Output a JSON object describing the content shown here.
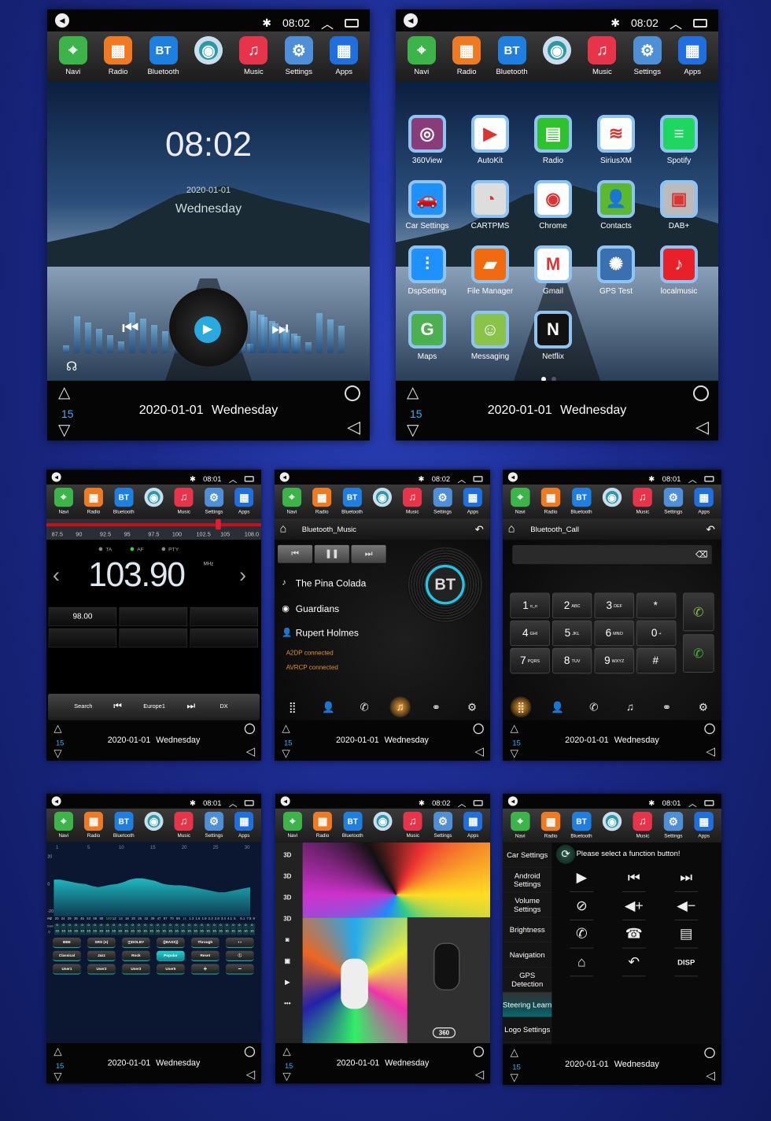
{
  "dock": [
    {
      "label": "Navi",
      "icon": "map-pin-icon",
      "color": "#3cb44a"
    },
    {
      "label": "Radio",
      "icon": "radio-icon",
      "color": "#f07a22"
    },
    {
      "label": "Bluetooth",
      "icon": "bluetooth-icon",
      "color": "#1e7fe0",
      "text": "BT"
    },
    {
      "label": "",
      "icon": "disc-icon",
      "color": "#2a9aa8"
    },
    {
      "label": "Music",
      "icon": "music-note-icon",
      "color": "#e8344a"
    },
    {
      "label": "Settings",
      "icon": "gear-icon",
      "color": "#4f8fd8"
    },
    {
      "label": "Apps",
      "icon": "apps-grid-icon",
      "color": "#1f6fe0"
    }
  ],
  "nav": {
    "volume": "15",
    "date": "2020-01-01",
    "day": "Wednesday"
  },
  "screens": [
    {
      "id": "home",
      "time": "08:02",
      "clock": "08:02",
      "date": "2020-01-01",
      "day": "Wednesday"
    },
    {
      "id": "apps",
      "time": "08:02",
      "page_dots": 2,
      "active_page": 1,
      "apps": [
        {
          "label": "360View",
          "color": "#8a3c7a",
          "glyph": "◎"
        },
        {
          "label": "AutoKit",
          "color": "#ffffff",
          "glyph": "▶"
        },
        {
          "label": "Radio",
          "color": "#2ec22e",
          "glyph": "▤"
        },
        {
          "label": "SiriusXM",
          "color": "#ffffff",
          "glyph": "≋"
        },
        {
          "label": "Spotify",
          "color": "#1ed760",
          "glyph": "≡"
        },
        {
          "label": "Car Settings",
          "color": "#1e90ff",
          "glyph": "🚗"
        },
        {
          "label": "CARTPMS",
          "color": "#dddddd",
          "glyph": "◔"
        },
        {
          "label": "Chrome",
          "color": "#ffffff",
          "glyph": "◉"
        },
        {
          "label": "Contacts",
          "color": "#5cb82e",
          "glyph": "👤"
        },
        {
          "label": "DAB+",
          "color": "#bbbbbb",
          "glyph": "▣"
        },
        {
          "label": "DspSetting",
          "color": "#1e90ff",
          "glyph": "⫶"
        },
        {
          "label": "File Manager",
          "color": "#f26a10",
          "glyph": "▰"
        },
        {
          "label": "Gmail",
          "color": "#ffffff",
          "glyph": "M"
        },
        {
          "label": "GPS Test",
          "color": "#3a6fb0",
          "glyph": "✺"
        },
        {
          "label": "localmusic",
          "color": "#e8202a",
          "glyph": "♪"
        },
        {
          "label": "Maps",
          "color": "#4caf50",
          "glyph": "G"
        },
        {
          "label": "Messaging",
          "color": "#8bc34a",
          "glyph": "☺"
        },
        {
          "label": "Netflix",
          "color": "#111111",
          "glyph": "N"
        }
      ]
    },
    {
      "id": "radio",
      "time": "08:01",
      "scale": [
        "87.5",
        "90",
        "92.5",
        "95",
        "97.5",
        "100",
        "102.5",
        "105",
        "108.0"
      ],
      "tuner_fraction": 0.8,
      "flags": [
        {
          "label": "TA",
          "on": false
        },
        {
          "label": "AF",
          "on": true
        },
        {
          "label": "PTY",
          "on": false
        }
      ],
      "frequency": "103.90",
      "unit": "MHz",
      "presets": [
        "98.00",
        "",
        "",
        "",
        "",
        ""
      ],
      "controls": {
        "search": "Search",
        "station": "Europe1",
        "dx": "DX"
      }
    },
    {
      "id": "bt_music",
      "time": "08:02",
      "title": "Bluetooth_Music",
      "song": "The Pina Colada",
      "album": "Guardians",
      "artist": "Rupert Holmes",
      "status": [
        "A2DP connected",
        "AVRCP connected"
      ],
      "logo": "BT",
      "active_tab": 3
    },
    {
      "id": "bt_call",
      "time": "08:01",
      "title": "Bluetooth_Call",
      "keys": [
        [
          "1",
          "o_o"
        ],
        [
          "2",
          "ABC"
        ],
        [
          "3",
          "DEF"
        ],
        [
          "*",
          ""
        ],
        [
          "4",
          "GHI"
        ],
        [
          "5",
          "JKL"
        ],
        [
          "6",
          "MNO"
        ],
        [
          "0",
          "+"
        ],
        [
          "7",
          "PQRS"
        ],
        [
          "8",
          "TUV"
        ],
        [
          "9",
          "WXYZ"
        ],
        [
          "#",
          ""
        ]
      ],
      "active_tab": 0
    },
    {
      "id": "eq",
      "time": "08:01",
      "bands": [
        "1",
        "5",
        "10",
        "15",
        "20",
        "25",
        "30"
      ],
      "y_ticks": [
        "20",
        "0",
        "-20"
      ],
      "hz": [
        "20",
        "24",
        "29",
        "36",
        "45",
        "53",
        "65",
        "80",
        "100",
        "12",
        "14",
        "18",
        "20",
        "26",
        "32",
        "39",
        "47",
        "57",
        "70",
        "85",
        "1k",
        "1.3",
        "1.6",
        "1.9",
        "2.3",
        "2.8",
        "3.4",
        "4.1",
        "5",
        "6.1",
        "7.5",
        "9"
      ],
      "hz_label": "Hz",
      "gain_label": "Gain",
      "q_label": "Q",
      "gain_value": "0",
      "q_value": "16",
      "gains": [
        4,
        4,
        3,
        2,
        1,
        0.5,
        -1,
        -2,
        -1,
        0,
        0.5,
        2,
        4,
        5,
        5,
        4,
        3,
        1,
        0,
        -0.5,
        -0.5,
        -1,
        -2,
        -3,
        -4,
        -5,
        -6,
        -6,
        -5,
        -4,
        -3,
        -2
      ],
      "buttons": [
        [
          "BBE",
          "SRS (●)",
          "◫DOLBY",
          "((BASS))",
          "Through",
          "◖◗"
        ],
        [
          "Classical",
          "Jazz",
          "Rock",
          "Popular",
          "Reset",
          "ⓘ"
        ],
        [
          "User1",
          "User2",
          "User3",
          "User5",
          "+",
          "−"
        ]
      ],
      "active_button": "Popular"
    },
    {
      "id": "camera",
      "time": "08:02",
      "tools": [
        "3D",
        "3D",
        "3D",
        "3D",
        "◙",
        "▣",
        "▶",
        "•••"
      ],
      "badge": "360"
    },
    {
      "id": "car_settings",
      "time": "08:01",
      "menu": [
        "Car Settings",
        "Android Settings",
        "Volume Settings",
        "Brightness",
        "Navigation",
        "GPS Detection",
        "Steering Learn",
        "Logo Settings"
      ],
      "active_menu": 6,
      "prompt": "Please select a function button!",
      "functions": [
        {
          "icon": "play-icon",
          "g": "▶"
        },
        {
          "icon": "previous-icon",
          "g": "⏮"
        },
        {
          "icon": "next-icon",
          "g": "⏭"
        },
        {
          "icon": "mute-icon",
          "g": "⊘"
        },
        {
          "icon": "volume-up-icon",
          "g": "◀+"
        },
        {
          "icon": "volume-down-icon",
          "g": "◀−"
        },
        {
          "icon": "phone-icon",
          "g": "✆"
        },
        {
          "icon": "hang-up-icon",
          "g": "☎"
        },
        {
          "icon": "radio-icon",
          "g": "▤"
        },
        {
          "icon": "home-icon",
          "g": "⌂"
        },
        {
          "icon": "back-icon",
          "g": "↶"
        },
        {
          "icon": "disp-button",
          "g": "DISP"
        }
      ]
    }
  ]
}
